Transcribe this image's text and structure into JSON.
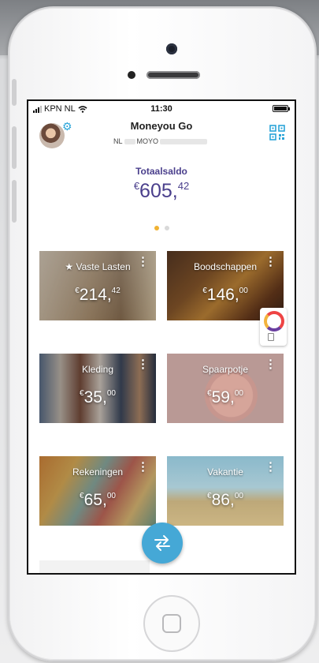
{
  "status_bar": {
    "carrier": "KPN NL",
    "time": "11:30"
  },
  "header": {
    "title": "Moneyou Go",
    "iban_prefix": "NL",
    "iban_middle": "MOYO"
  },
  "balance": {
    "label": "Totaalsaldo",
    "currency": "€",
    "whole": "605,",
    "decimals": "42"
  },
  "pager": {
    "pages": 2,
    "active_index": 0
  },
  "pots": [
    {
      "label": "Vaste Lasten",
      "starred": true,
      "currency": "€",
      "whole": "214,",
      "decimals": "42",
      "image": "house-and-coins"
    },
    {
      "label": "Boodschappen",
      "starred": false,
      "currency": "€",
      "whole": "146,",
      "decimals": "00",
      "image": "grocery-basket"
    },
    {
      "label": "Kleding",
      "starred": false,
      "currency": "€",
      "whole": "35,",
      "decimals": "00",
      "image": "clothing-rack"
    },
    {
      "label": "Spaarpotje",
      "starred": false,
      "currency": "€",
      "whole": "59,",
      "decimals": "00",
      "image": "piggy-bank"
    },
    {
      "label": "Rekeningen",
      "starred": false,
      "currency": "€",
      "whole": "65,",
      "decimals": "00",
      "image": "euro-banknotes"
    },
    {
      "label": "Vakantie",
      "starred": false,
      "currency": "€",
      "whole": "86,",
      "decimals": "00",
      "image": "pineapples-sunglasses"
    }
  ],
  "icons": {
    "settings": "gear-icon",
    "qr": "qr-code-icon",
    "transfer": "transfer-arrows-icon",
    "star": "star-icon",
    "menu": "more-vertical-icon"
  },
  "colors": {
    "accent": "#45a8d6",
    "balance_text": "#4a3f8c",
    "pager_active": "#f0b233"
  }
}
